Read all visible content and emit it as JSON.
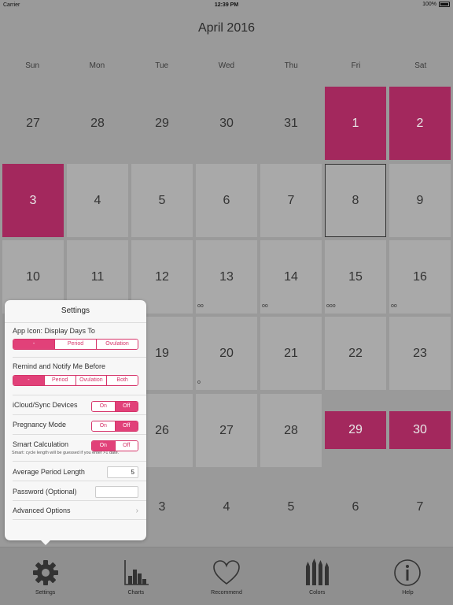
{
  "status_bar": {
    "carrier": "Carrier",
    "time": "12:39 PM",
    "battery": "100%"
  },
  "calendar": {
    "title": "April 2016",
    "weekdays": [
      "Sun",
      "Mon",
      "Tue",
      "Wed",
      "Thu",
      "Fri",
      "Sat"
    ],
    "days": [
      {
        "label": "27",
        "row": 0,
        "col": 0,
        "style": "blank"
      },
      {
        "label": "28",
        "row": 0,
        "col": 1,
        "style": "blank"
      },
      {
        "label": "29",
        "row": 0,
        "col": 2,
        "style": "blank"
      },
      {
        "label": "30",
        "row": 0,
        "col": 3,
        "style": "blank"
      },
      {
        "label": "31",
        "row": 0,
        "col": 4,
        "style": "blank"
      },
      {
        "label": "1",
        "row": 0,
        "col": 5,
        "style": "period"
      },
      {
        "label": "2",
        "row": 0,
        "col": 6,
        "style": "period"
      },
      {
        "label": "3",
        "row": 1,
        "col": 0,
        "style": "period"
      },
      {
        "label": "4",
        "row": 1,
        "col": 1,
        "style": "normal"
      },
      {
        "label": "5",
        "row": 1,
        "col": 2,
        "style": "normal"
      },
      {
        "label": "6",
        "row": 1,
        "col": 3,
        "style": "normal"
      },
      {
        "label": "7",
        "row": 1,
        "col": 4,
        "style": "normal"
      },
      {
        "label": "8",
        "row": 1,
        "col": 5,
        "style": "today"
      },
      {
        "label": "9",
        "row": 1,
        "col": 6,
        "style": "normal"
      },
      {
        "label": "10",
        "row": 2,
        "col": 0,
        "style": "normal"
      },
      {
        "label": "11",
        "row": 2,
        "col": 1,
        "style": "normal"
      },
      {
        "label": "12",
        "row": 2,
        "col": 2,
        "style": "normal"
      },
      {
        "label": "13",
        "row": 2,
        "col": 3,
        "style": "normal",
        "dots": "oo"
      },
      {
        "label": "14",
        "row": 2,
        "col": 4,
        "style": "normal",
        "dots": "oo"
      },
      {
        "label": "15",
        "row": 2,
        "col": 5,
        "style": "normal",
        "dots": "ooo"
      },
      {
        "label": "16",
        "row": 2,
        "col": 6,
        "style": "normal",
        "dots": "oo"
      },
      {
        "label": "19",
        "row": 3,
        "col": 2,
        "style": "normal"
      },
      {
        "label": "20",
        "row": 3,
        "col": 3,
        "style": "normal",
        "dots": "o"
      },
      {
        "label": "21",
        "row": 3,
        "col": 4,
        "style": "normal"
      },
      {
        "label": "22",
        "row": 3,
        "col": 5,
        "style": "normal"
      },
      {
        "label": "23",
        "row": 3,
        "col": 6,
        "style": "normal"
      },
      {
        "label": "26",
        "row": 4,
        "col": 2,
        "style": "normal"
      },
      {
        "label": "27",
        "row": 4,
        "col": 3,
        "style": "normal"
      },
      {
        "label": "28",
        "row": 4,
        "col": 4,
        "style": "normal"
      },
      {
        "label": "29",
        "row": 4,
        "col": 5,
        "style": "period-small"
      },
      {
        "label": "30",
        "row": 4,
        "col": 6,
        "style": "period-small"
      },
      {
        "label": "3",
        "row": 5,
        "col": 2,
        "style": "blank"
      },
      {
        "label": "4",
        "row": 5,
        "col": 3,
        "style": "blank"
      },
      {
        "label": "5",
        "row": 5,
        "col": 4,
        "style": "blank"
      },
      {
        "label": "6",
        "row": 5,
        "col": 5,
        "style": "blank"
      },
      {
        "label": "7",
        "row": 5,
        "col": 6,
        "style": "blank"
      }
    ]
  },
  "settings": {
    "title": "Settings",
    "app_icon": {
      "label": "App Icon: Display Days To",
      "options": [
        "-",
        "Period",
        "Ovulation"
      ],
      "selected": 0
    },
    "remind": {
      "label": "Remind and Notify Me Before",
      "options": [
        "-",
        "Period",
        "Ovulation",
        "Both"
      ],
      "selected": 0
    },
    "icloud": {
      "label": "iCloud/Sync Devices",
      "on": "On",
      "off": "Off",
      "value": "off"
    },
    "pregnancy": {
      "label": "Pregnancy Mode",
      "on": "On",
      "off": "Off",
      "value": "off"
    },
    "smart": {
      "label": "Smart Calculation",
      "on": "On",
      "off": "Off",
      "value": "on",
      "note": "Smart: cycle length will be guessed if you enter >1 date."
    },
    "avg_period": {
      "label": "Average Period Length",
      "value": "5"
    },
    "password": {
      "label": "Password (Optional)",
      "value": ""
    },
    "advanced": {
      "label": "Advanced Options",
      "chevron": "›"
    }
  },
  "tabbar": {
    "items": [
      {
        "label": "Settings",
        "icon": "gear-icon"
      },
      {
        "label": "Charts",
        "icon": "bar-chart-icon"
      },
      {
        "label": "Recommend",
        "icon": "heart-icon"
      },
      {
        "label": "Colors",
        "icon": "pencils-icon"
      },
      {
        "label": "Help",
        "icon": "info-icon"
      }
    ]
  }
}
